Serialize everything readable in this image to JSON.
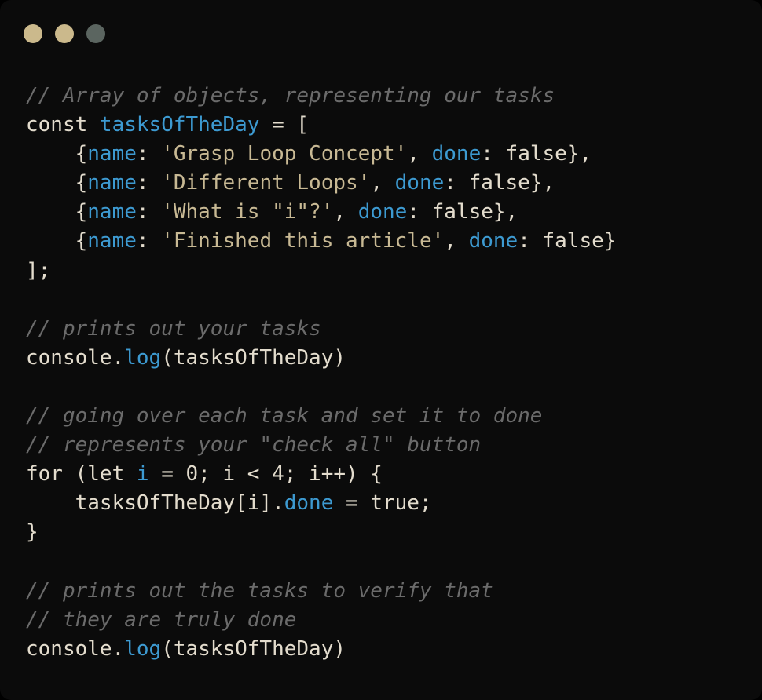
{
  "window": {
    "controls": [
      {
        "name": "close",
        "color": "#cbb98c"
      },
      {
        "name": "minimize",
        "color": "#cbb98c"
      },
      {
        "name": "maximize",
        "color": "#5b6560"
      }
    ]
  },
  "theme": {
    "background": "#0b0b0b",
    "text": "#e3dccd",
    "comment": "#6b6b6b",
    "property": "#3d9ad1",
    "string": "#c8b994"
  },
  "code": {
    "lines": [
      [
        {
          "t": "// Array of objects, representing our tasks",
          "c": "comment"
        }
      ],
      [
        {
          "t": "const ",
          "c": "text"
        },
        {
          "t": "tasksOfTheDay",
          "c": "property"
        },
        {
          "t": " = [",
          "c": "text"
        }
      ],
      [
        {
          "t": "    {",
          "c": "text"
        },
        {
          "t": "name",
          "c": "property"
        },
        {
          "t": ": ",
          "c": "text"
        },
        {
          "t": "'Grasp Loop Concept'",
          "c": "string"
        },
        {
          "t": ", ",
          "c": "text"
        },
        {
          "t": "done",
          "c": "property"
        },
        {
          "t": ": false},",
          "c": "text"
        }
      ],
      [
        {
          "t": "    {",
          "c": "text"
        },
        {
          "t": "name",
          "c": "property"
        },
        {
          "t": ": ",
          "c": "text"
        },
        {
          "t": "'Different Loops'",
          "c": "string"
        },
        {
          "t": ", ",
          "c": "text"
        },
        {
          "t": "done",
          "c": "property"
        },
        {
          "t": ": false},",
          "c": "text"
        }
      ],
      [
        {
          "t": "    {",
          "c": "text"
        },
        {
          "t": "name",
          "c": "property"
        },
        {
          "t": ": ",
          "c": "text"
        },
        {
          "t": "'What is \"i\"?'",
          "c": "string"
        },
        {
          "t": ", ",
          "c": "text"
        },
        {
          "t": "done",
          "c": "property"
        },
        {
          "t": ": false},",
          "c": "text"
        }
      ],
      [
        {
          "t": "    {",
          "c": "text"
        },
        {
          "t": "name",
          "c": "property"
        },
        {
          "t": ": ",
          "c": "text"
        },
        {
          "t": "'Finished this article'",
          "c": "string"
        },
        {
          "t": ", ",
          "c": "text"
        },
        {
          "t": "done",
          "c": "property"
        },
        {
          "t": ": false}",
          "c": "text"
        }
      ],
      [
        {
          "t": "];",
          "c": "text"
        }
      ],
      [],
      [
        {
          "t": "// prints out your tasks",
          "c": "comment"
        }
      ],
      [
        {
          "t": "console.",
          "c": "text"
        },
        {
          "t": "log",
          "c": "property"
        },
        {
          "t": "(tasksOfTheDay)",
          "c": "text"
        }
      ],
      [],
      [
        {
          "t": "// going over each task and set it to done",
          "c": "comment"
        }
      ],
      [
        {
          "t": "// represents your \"check all\" button",
          "c": "comment"
        }
      ],
      [
        {
          "t": "for (let ",
          "c": "text"
        },
        {
          "t": "i",
          "c": "property"
        },
        {
          "t": " = 0; i < 4; i++) {",
          "c": "text"
        }
      ],
      [
        {
          "t": "    tasksOfTheDay[i].",
          "c": "text"
        },
        {
          "t": "done",
          "c": "property"
        },
        {
          "t": " = true;",
          "c": "text"
        }
      ],
      [
        {
          "t": "}",
          "c": "text"
        }
      ],
      [],
      [
        {
          "t": "// prints out the tasks to verify that",
          "c": "comment"
        }
      ],
      [
        {
          "t": "// they are truly done",
          "c": "comment"
        }
      ],
      [
        {
          "t": "console.",
          "c": "text"
        },
        {
          "t": "log",
          "c": "property"
        },
        {
          "t": "(tasksOfTheDay)",
          "c": "text"
        }
      ]
    ]
  }
}
